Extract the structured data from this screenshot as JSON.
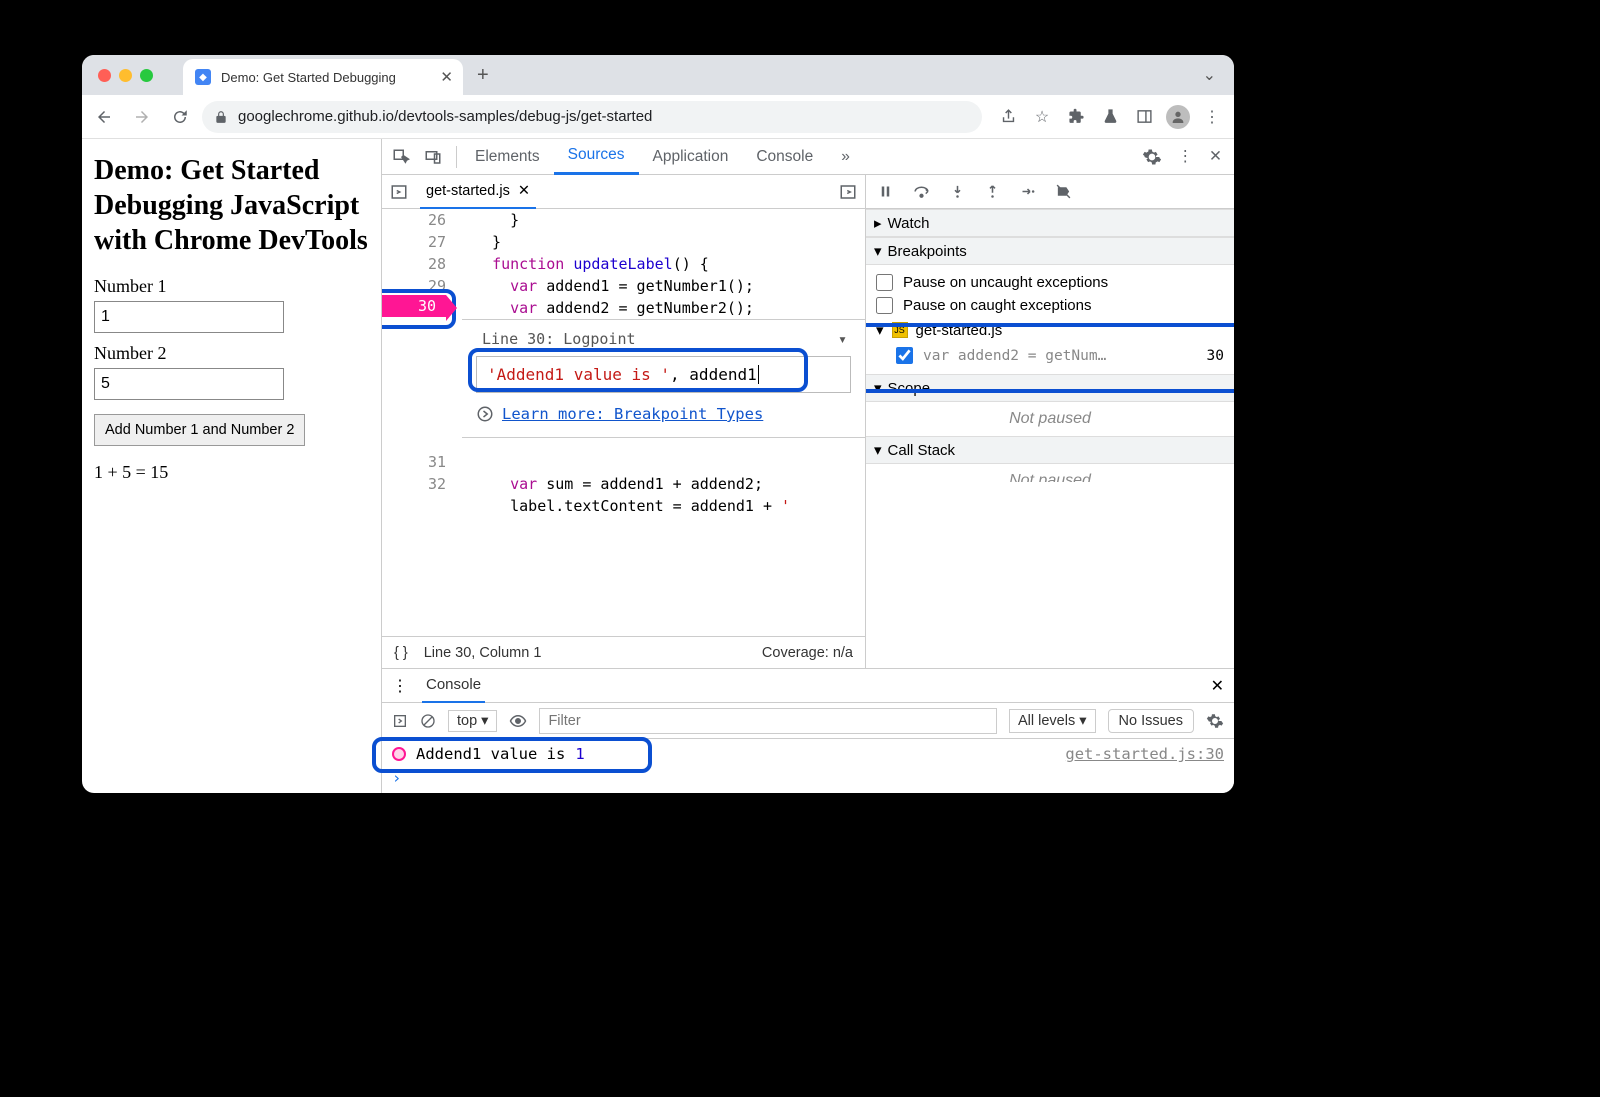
{
  "browser": {
    "tab_title": "Demo: Get Started Debugging",
    "url_display": "googlechrome.github.io/devtools-samples/debug-js/get-started"
  },
  "page": {
    "heading": "Demo: Get Started Debugging JavaScript with Chrome DevTools",
    "num1_label": "Number 1",
    "num1_value": "1",
    "num2_label": "Number 2",
    "num2_value": "5",
    "button_label": "Add Number 1 and Number 2",
    "result_text": "1 + 5 = 15"
  },
  "devtools": {
    "tabs": {
      "elements": "Elements",
      "sources": "Sources",
      "application": "Application",
      "console": "Console"
    },
    "editor": {
      "filename": "get-started.js",
      "lines": {
        "26": "    }",
        "27": "  }",
        "28": "  function updateLabel() {",
        "29": "    var addend1 = getNumber1();",
        "30": "    var addend2 = getNumber2();",
        "31": "    var sum = addend1 + addend2;",
        "32": "    label.textContent = addend1 + ' "
      },
      "logpoint": {
        "header": "Line 30:   Logpoint",
        "expression": "'Addend1 value is ', addend1",
        "learn_more": "Learn more: Breakpoint Types"
      },
      "status_line": "Line 30, Column 1",
      "coverage": "Coverage: n/a"
    },
    "debugger": {
      "watch": "Watch",
      "breakpoints": {
        "title": "Breakpoints",
        "uncaught": "Pause on uncaught exceptions",
        "caught": "Pause on caught exceptions",
        "file": "get-started.js",
        "snippet": "var addend2 = getNum…",
        "line": "30"
      },
      "scope": {
        "title": "Scope",
        "state": "Not paused"
      },
      "callstack": {
        "title": "Call Stack",
        "state": "Not paused"
      }
    },
    "console": {
      "tab": "Console",
      "context": "top",
      "filter_placeholder": "Filter",
      "levels": "All levels",
      "issues": "No Issues",
      "log_text": "Addend1 value is ",
      "log_value": "1",
      "source_link": "get-started.js:30"
    }
  }
}
